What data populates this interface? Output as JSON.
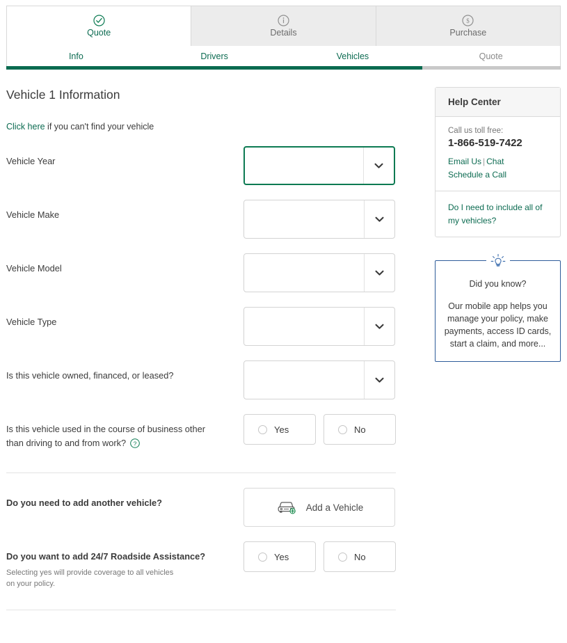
{
  "main_tabs": [
    {
      "label": "Quote",
      "icon": "check-circle-icon",
      "active": true
    },
    {
      "label": "Details",
      "icon": "info-circle-icon",
      "active": false
    },
    {
      "label": "Purchase",
      "icon": "dollar-circle-icon",
      "active": false
    }
  ],
  "sub_tabs": [
    {
      "label": "Info",
      "state": "complete"
    },
    {
      "label": "Drivers",
      "state": "complete"
    },
    {
      "label": "Vehicles",
      "state": "current"
    },
    {
      "label": "Quote",
      "state": "upcoming"
    }
  ],
  "progress": {
    "percent": 75
  },
  "page_title": "Vehicle 1 Information",
  "helper": {
    "link_text": "Click here",
    "rest_text": " if you can't find your vehicle"
  },
  "fields": {
    "vehicle_year": {
      "label": "Vehicle Year",
      "value": "",
      "focused": true
    },
    "vehicle_make": {
      "label": "Vehicle Make",
      "value": "",
      "focused": false
    },
    "vehicle_model": {
      "label": "Vehicle Model",
      "value": "",
      "focused": false
    },
    "vehicle_type": {
      "label": "Vehicle Type",
      "value": "",
      "focused": false
    },
    "ownership": {
      "label": "Is this vehicle owned, financed, or leased?",
      "value": "",
      "focused": false
    }
  },
  "business_use": {
    "question_line1": "Is this vehicle used in the course of business other",
    "question_line2": "than driving to and from work?",
    "yes_label": "Yes",
    "no_label": "No"
  },
  "another_vehicle": {
    "question": "Do you need to add another vehicle?",
    "button_label": "Add a Vehicle"
  },
  "roadside": {
    "question": "Do you want to add 24/7 Roadside Assistance?",
    "sub_line1": "Selecting yes will provide coverage to all vehicles",
    "sub_line2": "on your policy.",
    "yes_label": "Yes",
    "no_label": "No"
  },
  "help_center": {
    "title": "Help Center",
    "toll_free_label": "Call us toll free:",
    "phone": "1-866-519-7422",
    "email_link": "Email Us",
    "separator": "|",
    "chat_link": "Chat",
    "schedule_link": "Schedule a Call",
    "faq_link": "Do I need to include all of my vehicles?"
  },
  "did_you_know": {
    "title": "Did you know?",
    "text": "Our mobile app helps you manage your policy, make payments, access ID cards, start a claim, and more..."
  },
  "colors": {
    "brand_green": "#0c6b51",
    "progress_green": "#0a6b50",
    "focus_green": "#0c7a52",
    "tab_inactive_bg": "#ececec",
    "blue_border": "#2e5c9a",
    "muted_text": "#777777"
  }
}
